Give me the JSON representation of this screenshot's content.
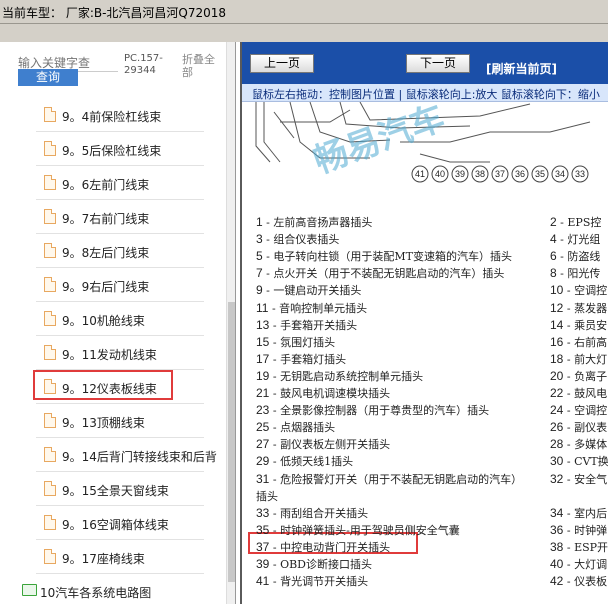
{
  "header": {
    "title": "当前车型：   厂家:B-北汽昌河昌河Q72018"
  },
  "left_panel": {
    "search": {
      "placeholder": "输入关键字查",
      "button_label": "查询"
    },
    "pc_code": "PC.157-29344",
    "collapse_all_label": "折叠全部",
    "tree_items": [
      {
        "label": "9。4前保险杠线束"
      },
      {
        "label": "9。5后保险杠线束"
      },
      {
        "label": "9。6左前门线束"
      },
      {
        "label": "9。7右前门线束"
      },
      {
        "label": "9。8左后门线束"
      },
      {
        "label": "9。9右后门线束"
      },
      {
        "label": "9。10机舱线束"
      },
      {
        "label": "9。11发动机线束"
      },
      {
        "label": "9。12仪表板线束"
      },
      {
        "label": "9。13顶棚线束"
      },
      {
        "label": "9。14后背门转接线束和后背"
      },
      {
        "label": "9。15全景天窗线束"
      },
      {
        "label": "9。16空调箱体线束"
      },
      {
        "label": "9。17座椅线束"
      }
    ],
    "selected_index": 8,
    "folder_item": {
      "label": "10汽车各系统电路图"
    }
  },
  "right_panel": {
    "nav": {
      "prev_label": "上一页",
      "next_label": "下一页",
      "refresh_label": "[刷新当前页]"
    },
    "hint": "鼠标左右拖动：控制图片位置 | 鼠标滚轮向上:放大  鼠标滚轮向下：缩小",
    "watermark": "畅易汽车",
    "connector_numbers": [
      "41",
      "40",
      "39",
      "38",
      "37",
      "36",
      "35",
      "34",
      "33"
    ],
    "legend_left": [
      {
        "num": "1",
        "text": " - 左前高音扬声器插头"
      },
      {
        "num": "3",
        "text": " - 组合仪表插头"
      },
      {
        "num": "5",
        "text": " - 电子转向柱锁（用于装配MT变速箱的汽车）插头"
      },
      {
        "num": "7",
        "text": " - 点火开关（用于不装配无钥匙启动的汽车）插头"
      },
      {
        "num": "9",
        "text": " - 一键启动开关插头"
      },
      {
        "num": "11",
        "text": " - 音响控制单元插头"
      },
      {
        "num": "13",
        "text": " - 手套箱开关插头"
      },
      {
        "num": "15",
        "text": " - 氛围灯插头"
      },
      {
        "num": "17",
        "text": " - 手套箱灯插头"
      },
      {
        "num": "19",
        "text": " - 无钥匙启动系统控制单元插头"
      },
      {
        "num": "21",
        "text": " - 鼓风电机调速模块插头"
      },
      {
        "num": "23",
        "text": " - 全景影像控制器（用于尊贵型的汽车）插头"
      },
      {
        "num": "25",
        "text": " - 点烟器插头"
      },
      {
        "num": "27",
        "text": " - 副仪表板左侧开关插头"
      },
      {
        "num": "29",
        "text": " - 低频天线1插头"
      },
      {
        "num": "31",
        "text": " - 危险报警灯开关（用于不装配无钥匙启动的汽车）"
      },
      {
        "num": "",
        "text": "插头"
      },
      {
        "num": "33",
        "text": " - 雨刮组合开关插头"
      },
      {
        "num": "35",
        "text": " - 时钟弹簧插头-用于驾驶员侧安全气囊"
      },
      {
        "num": "37",
        "text": " - 中控电动背门开关插头"
      },
      {
        "num": "39",
        "text": " - OBD诊断接口插头"
      },
      {
        "num": "41",
        "text": " - 背光调节开关插头"
      }
    ],
    "legend_right": [
      {
        "num": "2",
        "text": " - EPS控"
      },
      {
        "num": "4",
        "text": " - 灯光组"
      },
      {
        "num": "6",
        "text": " - 防盗线"
      },
      {
        "num": "8",
        "text": " - 阳光传"
      },
      {
        "num": "10",
        "text": " - 空调控"
      },
      {
        "num": "12",
        "text": " - 蒸发器"
      },
      {
        "num": "14",
        "text": " - 乘员安"
      },
      {
        "num": "16",
        "text": " - 右前高"
      },
      {
        "num": "18",
        "text": " - 前大灯"
      },
      {
        "num": "20",
        "text": " - 负离子"
      },
      {
        "num": "22",
        "text": " - 鼓风电"
      },
      {
        "num": "24",
        "text": " - 空调控"
      },
      {
        "num": "26",
        "text": " - 副仪表"
      },
      {
        "num": "28",
        "text": " - 多媒体"
      },
      {
        "num": "30",
        "text": " - CVT换"
      },
      {
        "num": "32",
        "text": " - 安全气"
      },
      {
        "num": "",
        "text": ""
      },
      {
        "num": "34",
        "text": " - 室内后"
      },
      {
        "num": "36",
        "text": " - 时钟弹"
      },
      {
        "num": "38",
        "text": " - ESP开"
      },
      {
        "num": "40",
        "text": " - 大灯调"
      },
      {
        "num": "42",
        "text": " - 仪表板"
      }
    ]
  }
}
